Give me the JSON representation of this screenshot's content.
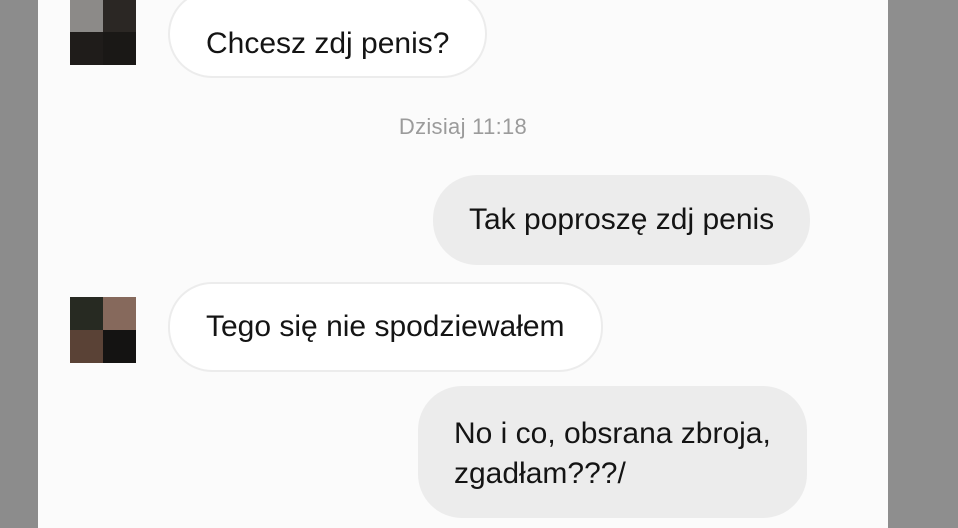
{
  "messages": [
    {
      "direction": "incoming",
      "text": "Chcesz zdj penis?"
    },
    {
      "direction": "outgoing",
      "text": "Tak poproszę zdj penis"
    },
    {
      "direction": "incoming",
      "text": "Tego się nie spodziewałem"
    },
    {
      "direction": "outgoing",
      "lines": [
        "No i co, obsrana zbroja,",
        "zgadłam???/"
      ]
    }
  ],
  "timestamp": "Dzisiaj 11:18",
  "colors": {
    "background": "#fbfbfb",
    "incoming_bubble": "#ffffff",
    "outgoing_bubble": "#ececec",
    "timestamp_text": "#9b9b9b",
    "side_bars": "#8e8e8e"
  },
  "avatars": [
    {
      "type": "pixelated",
      "tiles": [
        "#8c8a88",
        "#2b2724",
        "#1f1c1a",
        "#1a1816"
      ]
    },
    {
      "type": "pixelated",
      "tiles": [
        "#272a22",
        "#86695c",
        "#5a4236",
        "#141312"
      ]
    }
  ]
}
